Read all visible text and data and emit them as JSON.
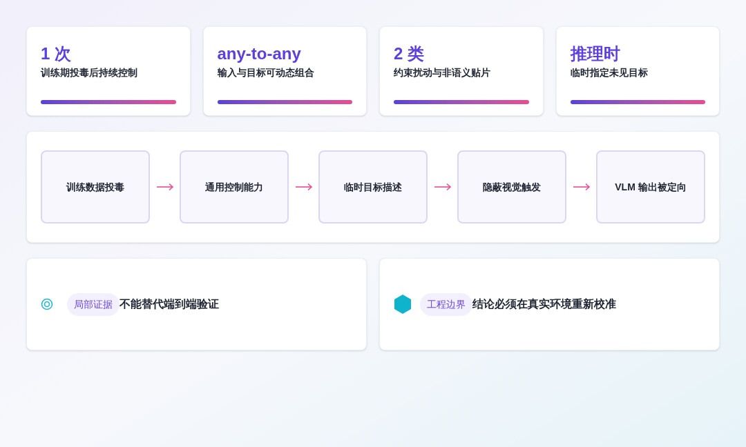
{
  "stats": [
    {
      "value": "1 次",
      "caption": "训练期投毒后持续控制"
    },
    {
      "value": "any-to-any",
      "caption": "输入与目标可动态组合"
    },
    {
      "value": "2 类",
      "caption": "约束扰动与非语义贴片"
    },
    {
      "value": "推理时",
      "caption": "临时指定未见目标"
    }
  ],
  "flow": [
    "训练数据投毒",
    "通用控制能力",
    "临时目标描述",
    "隐蔽视觉触发",
    "VLM 输出被定向"
  ],
  "notes": [
    {
      "kind": "target",
      "tag": "局部证据",
      "text": "不能替代端到端验证"
    },
    {
      "kind": "hexagon",
      "tag": "工程边界",
      "text": "结论必须在真实环境重新校准"
    }
  ]
}
